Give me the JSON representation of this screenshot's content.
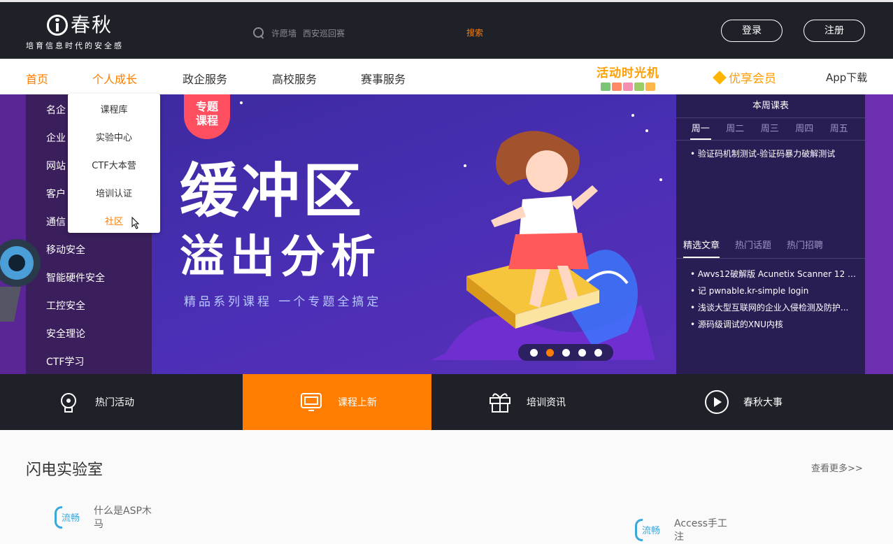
{
  "header": {
    "brand_name": "春秋",
    "slogan": "培育信息时代的安全感",
    "search_hints": [
      "许愿墙",
      "西安巡回赛"
    ],
    "search_button": "搜索",
    "login": "登录",
    "register": "注册"
  },
  "nav": {
    "items": [
      "首页",
      "个人成长",
      "政企服务",
      "高校服务",
      "赛事服务"
    ],
    "promo": "活动时光机",
    "vip": "优享会员",
    "app": "App下载",
    "accent": "#ff7d00"
  },
  "dropdown": {
    "items": [
      "课程库",
      "实验中心",
      "CTF大本营",
      "培训认证",
      "社区"
    ],
    "highlighted": "社区"
  },
  "side_menu": {
    "items": [
      "名企",
      "企业",
      "网站",
      "客户",
      "通信",
      "移动安全",
      "智能硬件安全",
      "工控安全",
      "安全理论",
      "CTF学习"
    ]
  },
  "hero": {
    "tag_line1": "专题",
    "tag_line2": "课程",
    "title1": "缓冲区",
    "title2": "溢出分析",
    "subtitle": "精品系列课程 一个专题全搞定",
    "slide_count": 5,
    "active_slide": 2
  },
  "schedule": {
    "title": "本周课表",
    "days": [
      "周一",
      "周二",
      "周三",
      "周四",
      "周五"
    ],
    "active_day": "周一",
    "course": "验证码机制测试-验证码暴力破解测试"
  },
  "articles": {
    "tabs": [
      "精选文章",
      "热门话题",
      "热门招聘"
    ],
    "active_tab": "精选文章",
    "items": [
      "Awvs12破解版 Acunetix Scanner 12 cr...",
      "记 pwnable.kr-simple login",
      "浅谈大型互联网的企业入侵检测及防护...",
      "源码级调试的XNU内核"
    ]
  },
  "features": {
    "items": [
      "热门活动",
      "课程上新",
      "培训资讯",
      "春秋大事"
    ],
    "active": "课程上新",
    "icons": [
      "bulb-icon",
      "monitor-icon",
      "gift-icon",
      "play-icon"
    ]
  },
  "lab": {
    "title": "闪电实验室",
    "more": "查看更多>>",
    "badge": "流畅",
    "cards": [
      "什么是ASP木马",
      "Access手工注"
    ]
  }
}
